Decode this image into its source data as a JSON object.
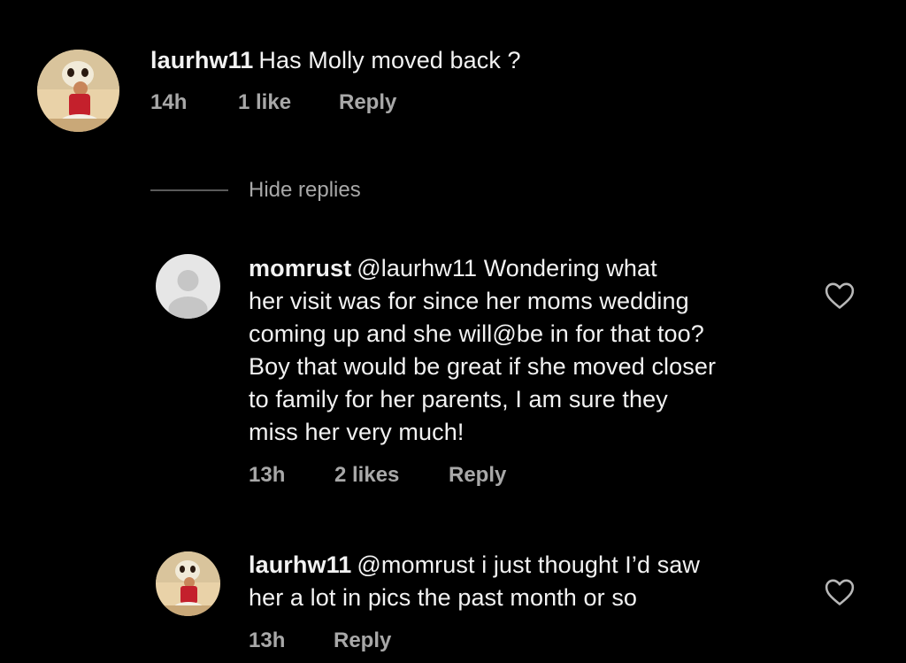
{
  "comment": {
    "username": "laurhw11",
    "text": "Has Molly moved back ?",
    "time": "14h",
    "likes": "1 like",
    "reply_label": "Reply"
  },
  "hide_replies_label": "Hide replies",
  "replies": [
    {
      "username": "momrust",
      "mention": "@laurhw11",
      "lines": [
        "Wondering what",
        "her visit was for since her moms wedding",
        "coming up and she will@be in for that too?",
        "Boy that would be great if she moved closer",
        "to family for her parents, I am sure they",
        "miss her very much!"
      ],
      "time": "13h",
      "likes": "2 likes",
      "reply_label": "Reply",
      "icon": "heart-outline-icon"
    },
    {
      "username": "laurhw11",
      "mention": "@momrust",
      "lines": [
        "i just thought I’d saw",
        "her a lot in pics the past month or so"
      ],
      "time": "13h",
      "reply_label": "Reply",
      "icon": "heart-outline-icon"
    }
  ],
  "colors": {
    "background": "#000000",
    "text": "#f2f2f2",
    "meta": "#a8a8a8",
    "avatar_default": "#e6e6e6"
  }
}
